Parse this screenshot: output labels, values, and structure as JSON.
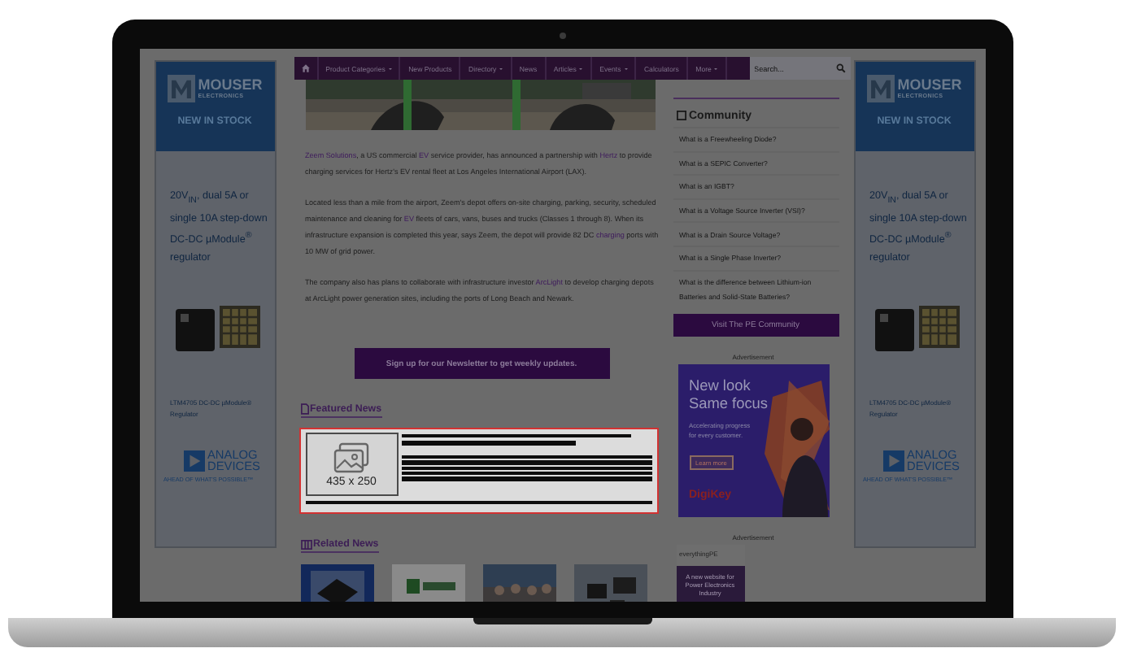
{
  "side_ads": [
    {
      "brand": "MOUSER",
      "brand_sub": "ELECTRONICS",
      "banner": "NEW IN STOCK",
      "headline": "20V$_{IN}$, dual 5A or single 10A step-down DC-DC µModule$^{®}$ regulator",
      "product": "LTM4705 DC-DC µModule® Regulator",
      "maker_line1": "ANALOG",
      "maker_line2": "DEVICES",
      "tagline": "AHEAD OF WHAT'S POSSIBLE™"
    },
    {
      "brand": "MOUSER",
      "brand_sub": "ELECTRONICS",
      "banner": "NEW IN STOCK",
      "headline": "20V$_{IN}$, dual 5A or single 10A step-down DC-DC µModule$^{®}$ regulator",
      "product": "LTM4705 DC-DC µModule® Regulator",
      "maker_line1": "ANALOG",
      "maker_line2": "DEVICES",
      "tagline": "AHEAD OF WHAT'S POSSIBLE™"
    }
  ],
  "nav": {
    "items": [
      {
        "label": "Product Categories",
        "dropdown": true
      },
      {
        "label": "New Products",
        "dropdown": false
      },
      {
        "label": "Directory",
        "dropdown": true
      },
      {
        "label": "News",
        "dropdown": false
      },
      {
        "label": "Articles",
        "dropdown": true
      },
      {
        "label": "Events",
        "dropdown": true
      },
      {
        "label": "Calculators",
        "dropdown": false
      },
      {
        "label": "More",
        "dropdown": true
      }
    ],
    "search": {
      "placeholder": "Search..."
    }
  },
  "article": {
    "paragraphs": [
      [
        {
          "text": "Zeem Solutions",
          "link": true
        },
        {
          "text": ", a US commercial ",
          "link": false
        },
        {
          "text": "EV",
          "link": true
        },
        {
          "text": " service provider, has announced a partnership with ",
          "link": false
        },
        {
          "text": "Hertz",
          "link": true
        },
        {
          "text": " to provide charging services for Hertz's EV rental fleet at Los Angeles International Airport (LAX).",
          "link": false
        }
      ],
      [
        {
          "text": "Located less than a mile from the airport, Zeem's depot offers on-site charging, parking, security, scheduled maintenance and cleaning for ",
          "link": false
        },
        {
          "text": "EV",
          "link": true
        },
        {
          "text": " fleets of cars, vans, buses and trucks (Classes 1 through 8). When its infrastructure expansion is completed this year, says Zeem, the depot will provide 82 DC ",
          "link": false
        },
        {
          "text": "charging",
          "link": true
        },
        {
          "text": " ports with 10 MW of grid power.",
          "link": false
        }
      ],
      [
        {
          "text": "The company also has plans to collaborate with infrastructure investor ",
          "link": false
        },
        {
          "text": "ArcLight",
          "link": true
        },
        {
          "text": " to develop charging depots at ArcLight power generation sites, including the ports of Long Beach and Newark.",
          "link": false
        }
      ]
    ]
  },
  "newsletter_button": "Sign up for our Newsletter to get weekly updates.",
  "featured_news": {
    "title": "Featured News",
    "image_placeholder": "435 x 250"
  },
  "related_news": {
    "title": "Related News"
  },
  "community": {
    "title": "Community",
    "items": [
      "What is a Freewheeling Diode?",
      "What is a SEPIC Converter?",
      "What is an IGBT?",
      "What is a Voltage Source Inverter (VSI)?",
      "What is a Drain Source Voltage?",
      "What is a Single Phase Inverter?",
      "What is the difference between Lithium-ion Batteries and Solid-State Batteries?"
    ],
    "button": "Visit The PE Community"
  },
  "ads": [
    {
      "kind": "digikey",
      "label": "Advertisement",
      "headline": [
        "New look",
        "Same focus"
      ],
      "subtext": "Accelerating progress for every customer.",
      "button": "Learn more",
      "brand": "DigiKey"
    },
    {
      "kind": "everythingpe",
      "label": "Advertisement",
      "brand": "everythingPE",
      "subtext": "A new website for Power Electronics Industry"
    }
  ]
}
